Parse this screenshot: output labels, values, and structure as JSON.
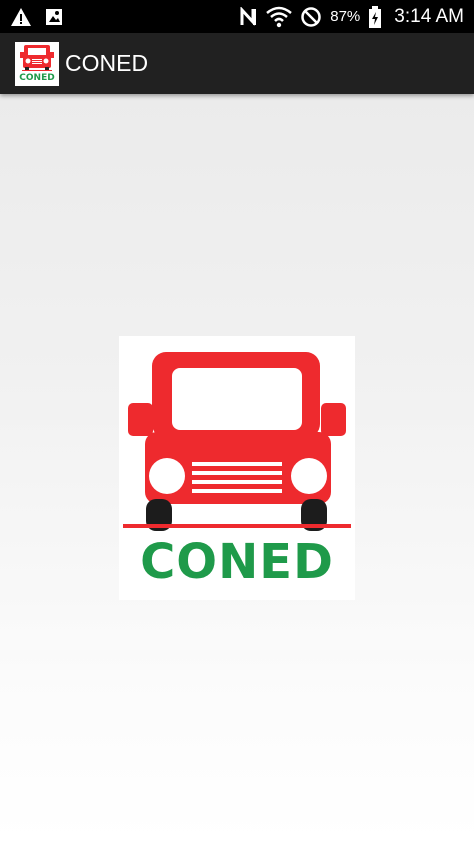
{
  "status_bar": {
    "icons": [
      "warning-icon",
      "image-notification-icon",
      "nfc-icon",
      "wifi-icon",
      "do-not-disturb-icon",
      "battery-charging-icon"
    ],
    "battery_percent": "87%",
    "time": "3:14 AM"
  },
  "action_bar": {
    "title": "CONED",
    "icon_text": "CONED"
  },
  "splash": {
    "logo_text": "CONED"
  },
  "colors": {
    "logo_red": "#ee2a2e",
    "logo_green": "#1f9a4a",
    "action_bar_bg": "#212121",
    "status_bar_bg": "#000000"
  }
}
